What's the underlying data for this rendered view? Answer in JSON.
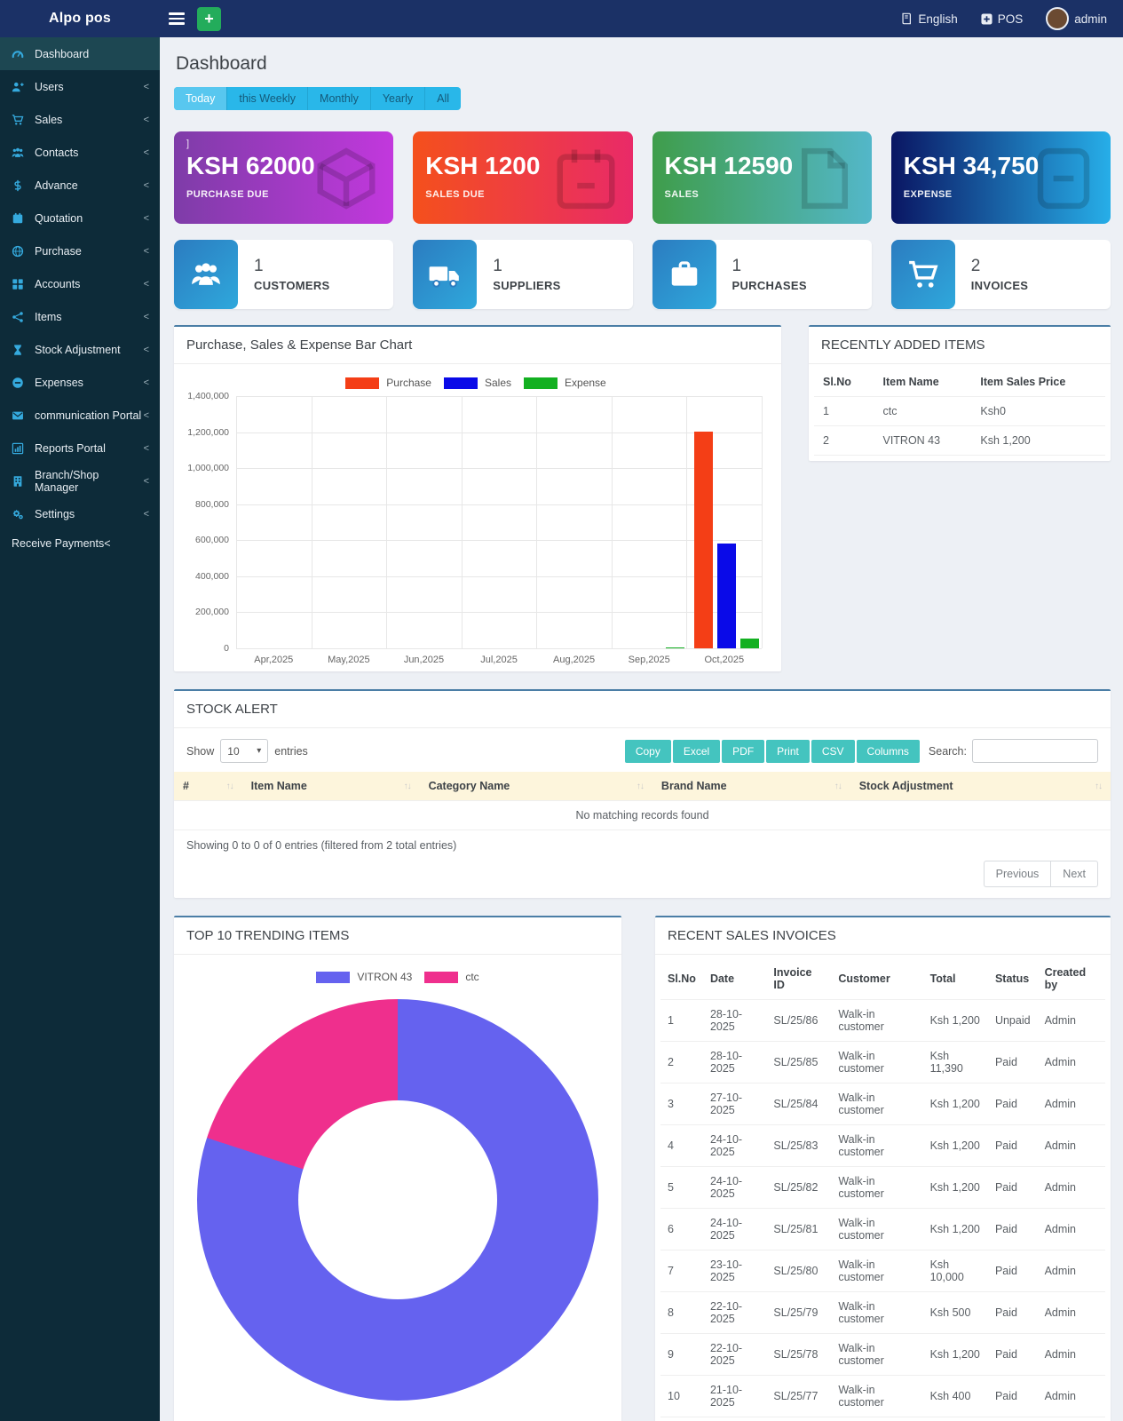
{
  "navbar": {
    "brand": "Alpo pos",
    "language": "English",
    "pos_label": "POS",
    "user": "admin"
  },
  "sidebar": {
    "items": [
      {
        "label": "Dashboard",
        "icon": "dashboard-icon",
        "active": true,
        "chevron": ""
      },
      {
        "label": "Users",
        "icon": "users-icon",
        "active": false,
        "chevron": "<"
      },
      {
        "label": "Sales",
        "icon": "cart-icon",
        "active": false,
        "chevron": "<"
      },
      {
        "label": "Contacts",
        "icon": "contacts-icon",
        "active": false,
        "chevron": "<"
      },
      {
        "label": "Advance",
        "icon": "dollar-icon",
        "active": false,
        "chevron": "<"
      },
      {
        "label": "Quotation",
        "icon": "calendar-icon",
        "active": false,
        "chevron": "<"
      },
      {
        "label": "Purchase",
        "icon": "globe-icon",
        "active": false,
        "chevron": "<"
      },
      {
        "label": "Accounts",
        "icon": "grid-icon",
        "active": false,
        "chevron": "<"
      },
      {
        "label": "Items",
        "icon": "share-nodes-icon",
        "active": false,
        "chevron": "<"
      },
      {
        "label": "Stock Adjustment",
        "icon": "hourglass-icon",
        "active": false,
        "chevron": "<"
      },
      {
        "label": "Expenses",
        "icon": "minus-circle-icon",
        "active": false,
        "chevron": "<"
      },
      {
        "label": "communication Portal",
        "icon": "envelope-icon",
        "active": false,
        "chevron": "<"
      },
      {
        "label": "Reports Portal",
        "icon": "bar-chart-icon",
        "active": false,
        "chevron": "<"
      },
      {
        "label": "Branch/Shop Manager",
        "icon": "building-icon",
        "active": false,
        "chevron": "<"
      },
      {
        "label": "Settings",
        "icon": "gears-icon",
        "active": false,
        "chevron": "<"
      }
    ],
    "footer_link": "Receive Payments<"
  },
  "page": {
    "title": "Dashboard"
  },
  "tabs": {
    "items": [
      "Today",
      "this Weekly",
      "Monthly",
      "Yearly",
      "All"
    ],
    "active_index": 0
  },
  "stat_cards": [
    {
      "badge": "]",
      "value": "KSH 62000",
      "label": "PURCHASE DUE",
      "icon": "box-icon",
      "color_from": "#7e3ca8",
      "color_to": "#c238dd"
    },
    {
      "badge": "",
      "value": "KSH 1200",
      "label": "SALES DUE",
      "icon": "calendar-icon",
      "color_from": "#f4501c",
      "color_to": "#e92a68"
    },
    {
      "badge": "",
      "value": "KSH 12590",
      "label": "SALES",
      "icon": "file-icon",
      "color_from": "#3f9d4b",
      "color_to": "#53b7c9"
    },
    {
      "badge": "",
      "value": "KSH 34,750",
      "label": "EXPENSE",
      "icon": "calculator-icon",
      "color_from": "#0a1663",
      "color_to": "#27aee8"
    }
  ],
  "count_cards": [
    {
      "value": "1",
      "label": "CUSTOMERS",
      "icon": "customers-icon"
    },
    {
      "value": "1",
      "label": "SUPPLIERS",
      "icon": "truck-icon"
    },
    {
      "value": "1",
      "label": "PURCHASES",
      "icon": "briefcase-icon"
    },
    {
      "value": "2",
      "label": "INVOICES",
      "icon": "shopping-cart-icon"
    }
  ],
  "chart_data": [
    {
      "type": "bar",
      "title": "Purchase, Sales & Expense Bar Chart",
      "categories": [
        "Apr,2025",
        "May,2025",
        "Jun,2025",
        "Jul,2025",
        "Aug,2025",
        "Sep,2025",
        "Oct,2025"
      ],
      "series": [
        {
          "name": "Purchase",
          "color": "#f43e16",
          "values": [
            0,
            0,
            0,
            0,
            0,
            0,
            1205000
          ]
        },
        {
          "name": "Sales",
          "color": "#0a0ae8",
          "values": [
            0,
            0,
            0,
            0,
            0,
            0,
            580000
          ]
        },
        {
          "name": "Expense",
          "color": "#13b021",
          "values": [
            0,
            0,
            0,
            0,
            0,
            2500,
            55000
          ]
        }
      ],
      "ylim": [
        0,
        1400000
      ],
      "ytick_step": 200000,
      "ytick_labels": [
        "0",
        "200,000",
        "400,000",
        "600,000",
        "800,000",
        "1,000,000",
        "1,200,000",
        "1,400,000"
      ],
      "grid": true,
      "legend_position": "top"
    },
    {
      "type": "pie",
      "title": "TOP 10 TRENDING ITEMS",
      "labels": [
        "VITRON 43",
        "ctc"
      ],
      "values": [
        80,
        20
      ],
      "colors": [
        "#6562ef",
        "#ef2f8d"
      ],
      "donut_hole": true,
      "legend_position": "top"
    }
  ],
  "recently_added": {
    "title": "RECENTLY ADDED ITEMS",
    "headers": [
      "Sl.No",
      "Item Name",
      "Item Sales Price"
    ],
    "rows": [
      [
        "1",
        "ctc",
        "Ksh0"
      ],
      [
        "2",
        "VITRON 43",
        "Ksh 1,200"
      ]
    ]
  },
  "stock_alert": {
    "title": "STOCK ALERT",
    "show_label": "Show",
    "page_size": "10",
    "entries_label": "entries",
    "export_buttons": [
      "Copy",
      "Excel",
      "PDF",
      "Print",
      "CSV",
      "Columns"
    ],
    "search_label": "Search:",
    "headers": [
      "#",
      "Item Name",
      "Category Name",
      "Brand Name",
      "Stock Adjustment"
    ],
    "empty_text": "No matching records found",
    "summary": "Showing 0 to 0 of 0 entries (filtered from 2 total entries)",
    "prev_label": "Previous",
    "next_label": "Next"
  },
  "trending": {
    "title": "TOP 10 TRENDING ITEMS"
  },
  "recent_invoices": {
    "title": "RECENT SALES INVOICES",
    "headers": [
      "Sl.No",
      "Date",
      "Invoice ID",
      "Customer",
      "Total",
      "Status",
      "Created by"
    ],
    "rows": [
      [
        "1",
        "28-10-2025",
        "SL/25/86",
        "Walk-in customer",
        "Ksh 1,200",
        "Unpaid",
        "Admin"
      ],
      [
        "2",
        "28-10-2025",
        "SL/25/85",
        "Walk-in customer",
        "Ksh 11,390",
        "Paid",
        "Admin"
      ],
      [
        "3",
        "27-10-2025",
        "SL/25/84",
        "Walk-in customer",
        "Ksh 1,200",
        "Paid",
        "Admin"
      ],
      [
        "4",
        "24-10-2025",
        "SL/25/83",
        "Walk-in customer",
        "Ksh 1,200",
        "Paid",
        "Admin"
      ],
      [
        "5",
        "24-10-2025",
        "SL/25/82",
        "Walk-in customer",
        "Ksh 1,200",
        "Paid",
        "Admin"
      ],
      [
        "6",
        "24-10-2025",
        "SL/25/81",
        "Walk-in customer",
        "Ksh 1,200",
        "Paid",
        "Admin"
      ],
      [
        "7",
        "23-10-2025",
        "SL/25/80",
        "Walk-in customer",
        "Ksh 10,000",
        "Paid",
        "Admin"
      ],
      [
        "8",
        "22-10-2025",
        "SL/25/79",
        "Walk-in customer",
        "Ksh 500",
        "Paid",
        "Admin"
      ],
      [
        "9",
        "22-10-2025",
        "SL/25/78",
        "Walk-in customer",
        "Ksh 1,200",
        "Paid",
        "Admin"
      ],
      [
        "10",
        "21-10-2025",
        "SL/25/77",
        "Walk-in customer",
        "Ksh 400",
        "Paid",
        "Admin"
      ]
    ]
  }
}
